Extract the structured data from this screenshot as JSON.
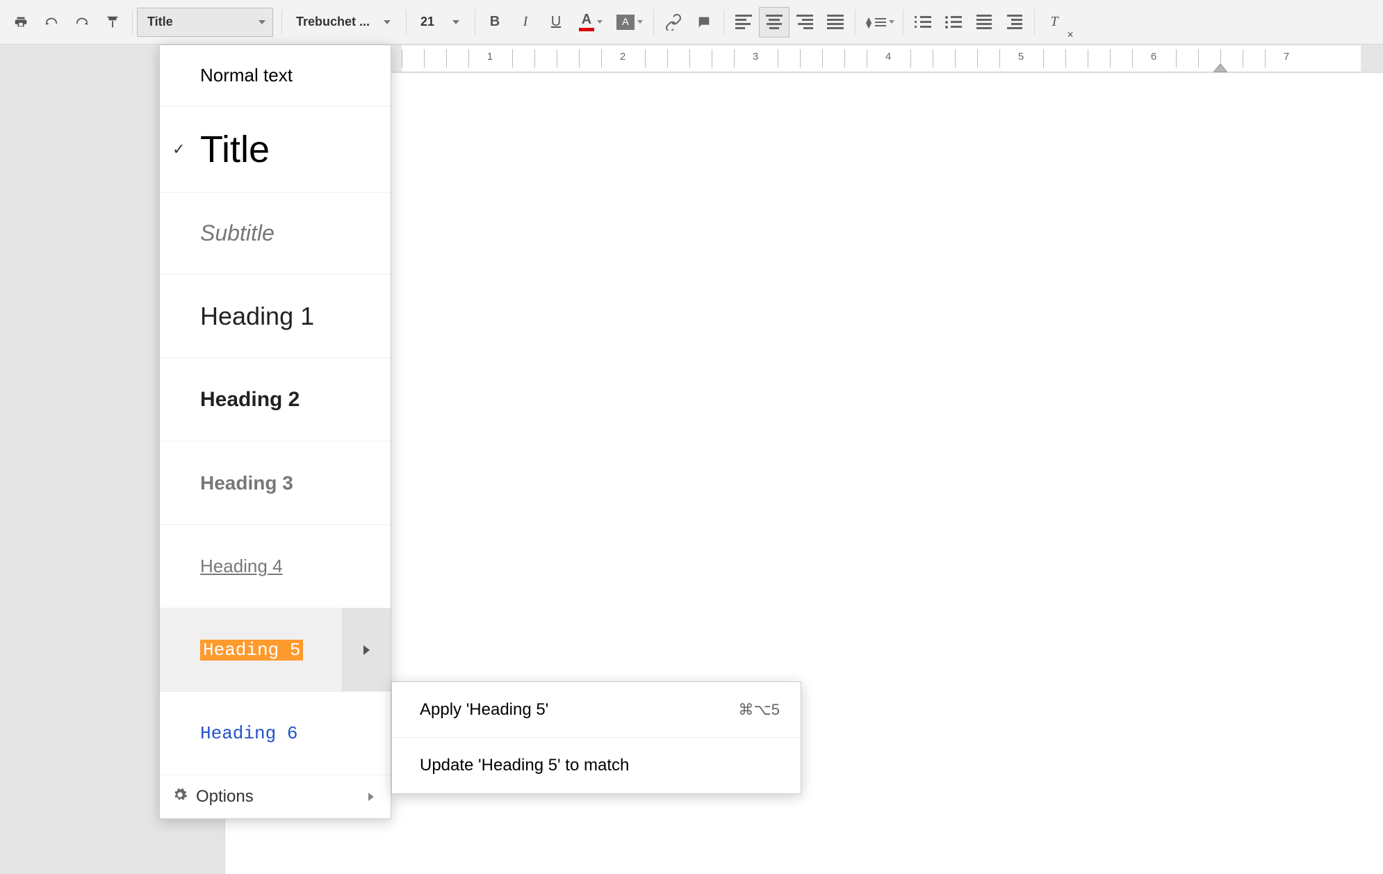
{
  "toolbar": {
    "style": "Title",
    "font": "Trebuchet ...",
    "font_size": "21"
  },
  "ruler": {
    "ticks": [
      "1",
      "2",
      "3",
      "4",
      "5",
      "6",
      "7"
    ]
  },
  "styles_menu": {
    "normal": "Normal text",
    "title": "Title",
    "subtitle": "Subtitle",
    "h1": "Heading 1",
    "h2": "Heading 2",
    "h3": "Heading 3",
    "h4": "Heading 4",
    "h5": "Heading 5",
    "h6": "Heading 6",
    "options": "Options"
  },
  "submenu": {
    "apply": "Apply 'Heading 5'",
    "apply_shortcut": "⌘⌥5",
    "update": "Update 'Heading 5' to match"
  },
  "letters": {
    "A": "A",
    "B": "B",
    "I": "I",
    "U": "U",
    "Tx": "T"
  }
}
